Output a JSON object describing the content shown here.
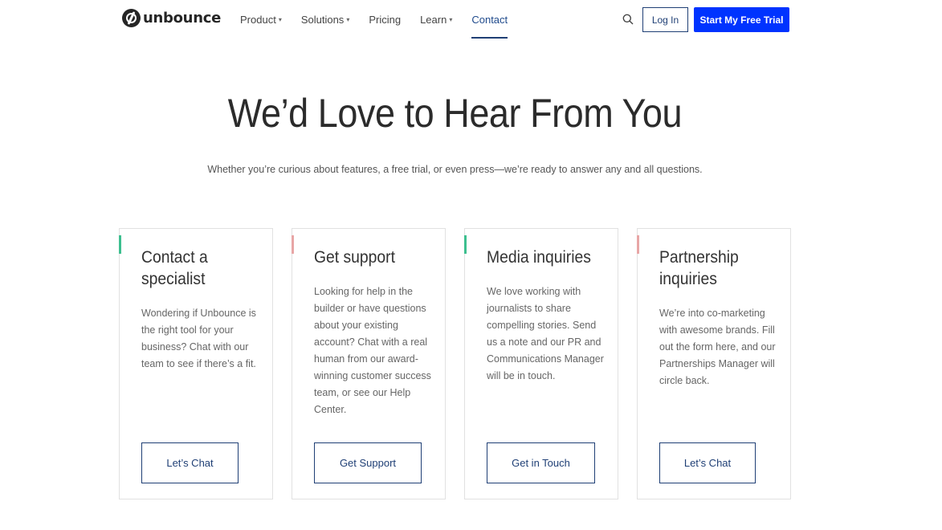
{
  "nav": {
    "logo": "unbounce",
    "items": [
      {
        "label": "Product",
        "dropdown": true,
        "chevron": "▾"
      },
      {
        "label": "Solutions",
        "dropdown": true,
        "chevron": "▾"
      },
      {
        "label": "Pricing",
        "dropdown": false,
        "chevron": ""
      },
      {
        "label": "Learn",
        "dropdown": true,
        "chevron": "▾"
      },
      {
        "label": "Contact",
        "dropdown": false,
        "chevron": "",
        "active": true
      }
    ],
    "search_icon": "search-icon",
    "login_label": "Log In",
    "trial_label": "Start My Free Trial"
  },
  "hero": {
    "title": "We’d Love to Hear From You",
    "subtitle": "Whether you’re curious about features, a free trial, or even press—we’re ready to answer any and all questions."
  },
  "colors": {
    "brand_blue": "#0033ff",
    "navy": "#1f3f75",
    "accent_green": "#3dbf8f",
    "accent_pink": "#e8a6a6"
  },
  "cards": [
    {
      "title": "Contact a specialist",
      "body": "Wondering if Unbounce is the right tool for your business? Chat with our team to see if there’s a fit.",
      "button": "Let’s Chat",
      "accent": "#3dbf8f"
    },
    {
      "title": "Get support",
      "body": "Looking for help in the builder or have questions about your existing account? Chat with a real human from our award-winning customer success team, or see our Help Center.",
      "button": "Get Support",
      "accent": "#e8a6a6"
    },
    {
      "title": "Media inquiries",
      "body": "We love working with journalists to share compelling stories. Send us a note and our PR and Communications Manager will be in touch.",
      "button": "Get in Touch",
      "accent": "#3dbf8f"
    },
    {
      "title": "Partnership inquiries",
      "body": "We’re into co-marketing with awesome brands. Fill out the form here, and our Partnerships Manager will circle back.",
      "button": "Let’s Chat",
      "accent": "#e8a6a6"
    }
  ]
}
